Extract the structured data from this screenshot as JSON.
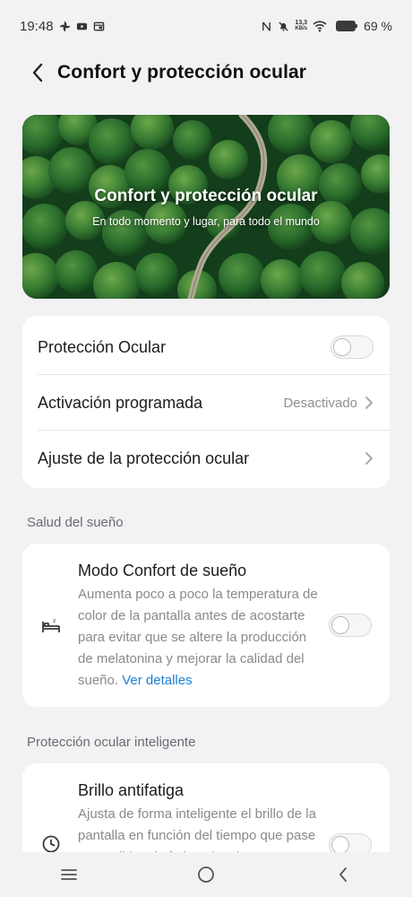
{
  "status_bar": {
    "time": "19:48",
    "net_speed_value": "13,3",
    "net_speed_unit": "KB/s",
    "battery": "69 %"
  },
  "header": {
    "title": "Confort y protección ocular"
  },
  "hero": {
    "title": "Confort y protección ocular",
    "subtitle": "En todo momento y lugar, para todo el mundo"
  },
  "settings": {
    "eye_protection_label": "Protección Ocular",
    "eye_protection_on": false,
    "scheduled_label": "Activación programada",
    "scheduled_value": "Desactivado",
    "adjust_label": "Ajuste de la protección ocular"
  },
  "sleep": {
    "section_title": "Salud del sueño",
    "title": "Modo Confort de sueño",
    "description": "Aumenta poco a poco la temperatura de color de la pantalla antes de acostarte para evitar que se altere la producción de melatonina y mejorar la calidad del sueño.",
    "link": "Ver detalles",
    "enabled": false
  },
  "smart": {
    "section_title": "Protección ocular inteligente",
    "title": "Brillo antifatiga",
    "description": "Ajusta de forma inteligente el brillo de la pantalla en función del tiempo que pase encendida y la fatiga visual.",
    "enabled": false
  },
  "colors": {
    "accent_link": "#1a7fd6",
    "background": "#f2f2f4"
  }
}
